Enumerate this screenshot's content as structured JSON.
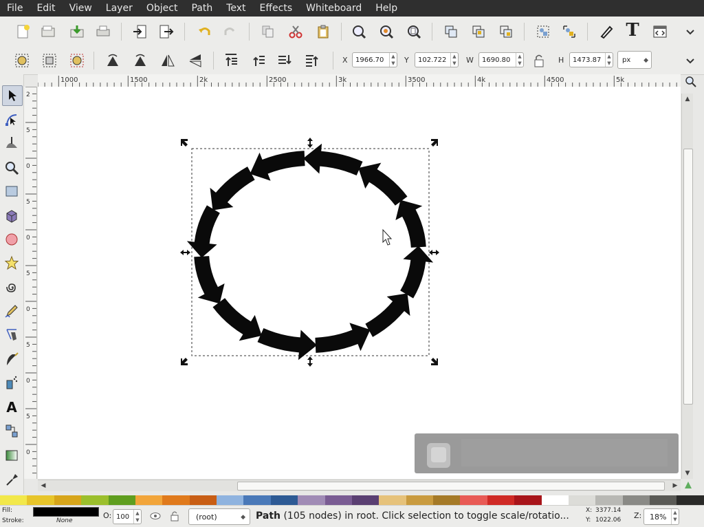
{
  "menu": [
    "File",
    "Edit",
    "View",
    "Layer",
    "Object",
    "Path",
    "Text",
    "Effects",
    "Whiteboard",
    "Help"
  ],
  "toolbar1": {
    "icons": [
      "new-document-icon",
      "open-document-icon",
      "save-document-icon",
      "print-icon",
      "import-icon",
      "export-icon",
      "undo-icon",
      "redo-icon",
      "copy-icon",
      "cut-icon",
      "paste-icon",
      "zoom-selection-icon",
      "zoom-drawing-icon",
      "zoom-page-icon",
      "duplicate-icon",
      "clone-icon",
      "unlink-clone-icon",
      "group-icon",
      "ungroup-icon",
      "fill-stroke-icon",
      "text-font-icon",
      "xml-editor-icon",
      "more-chevron-icon"
    ],
    "text_tool_glyph": "T"
  },
  "toolbar2": {
    "icons": [
      "select-all-icon",
      "select-all-layers-icon",
      "deselect-icon",
      "rotate-ccw-icon",
      "rotate-cw-icon",
      "flip-horizontal-icon",
      "flip-vertical-icon",
      "raise-to-top-icon",
      "raise-icon",
      "lower-icon",
      "lower-to-bottom-icon"
    ],
    "x_label": "X",
    "x_value": "1966.70",
    "y_label": "Y",
    "y_value": "102.722",
    "w_label": "W",
    "w_value": "1690.80",
    "h_label": "H",
    "h_value": "1473.87",
    "unit": "px"
  },
  "ruler_h": [
    "1000",
    "1500",
    "2k",
    "2500",
    "3k",
    "3500",
    "4k",
    "4500",
    "5k"
  ],
  "ruler_v": [
    "2",
    "5",
    "0",
    "5",
    "0",
    "5",
    "0",
    "5",
    "0",
    "5",
    "0"
  ],
  "tools": [
    "selector-arrow-icon",
    "node-editor-icon",
    "tweak-icon",
    "zoom-icon",
    "rectangle-icon",
    "box3d-icon",
    "ellipse-icon",
    "star-icon",
    "spiral-icon",
    "pencil-icon",
    "pen-icon",
    "calligraphy-icon",
    "spray-icon",
    "text-tool-icon",
    "connector-icon",
    "gradient-icon",
    "dropper-icon"
  ],
  "text_tool_glyph": "A",
  "palette": [
    "#f2e84a",
    "#e7c52a",
    "#d7a51a",
    "#9bbf2c",
    "#5f9e1f",
    "#f2a53a",
    "#e07a1c",
    "#c85e15",
    "#8fb3df",
    "#4a79b8",
    "#2d5a94",
    "#a08bb5",
    "#7a5c93",
    "#5a3f72",
    "#e6c27a",
    "#c99b3f",
    "#a57a27",
    "#e85a55",
    "#cf2a25",
    "#a8151a",
    "#ffffff",
    "#dcdcd8",
    "#b8b8b4",
    "#8a8a86",
    "#5a5a56",
    "#2a2a28"
  ],
  "status": {
    "fill_label": "Fill:",
    "stroke_label": "Stroke:",
    "stroke_value": "None",
    "fill_color": "#000000",
    "opacity_label": "O:",
    "opacity_value": "100",
    "layer_value": "(root)",
    "message_bold": "Path",
    "message_rest": " (105 nodes) in root. Click selection to toggle scale/rotatio...",
    "cursor_x_label": "X:",
    "cursor_x": "3377.14",
    "cursor_y_label": "Y:",
    "cursor_y": "1022.06",
    "zoom_label": "Z:",
    "zoom_value": "18%"
  }
}
